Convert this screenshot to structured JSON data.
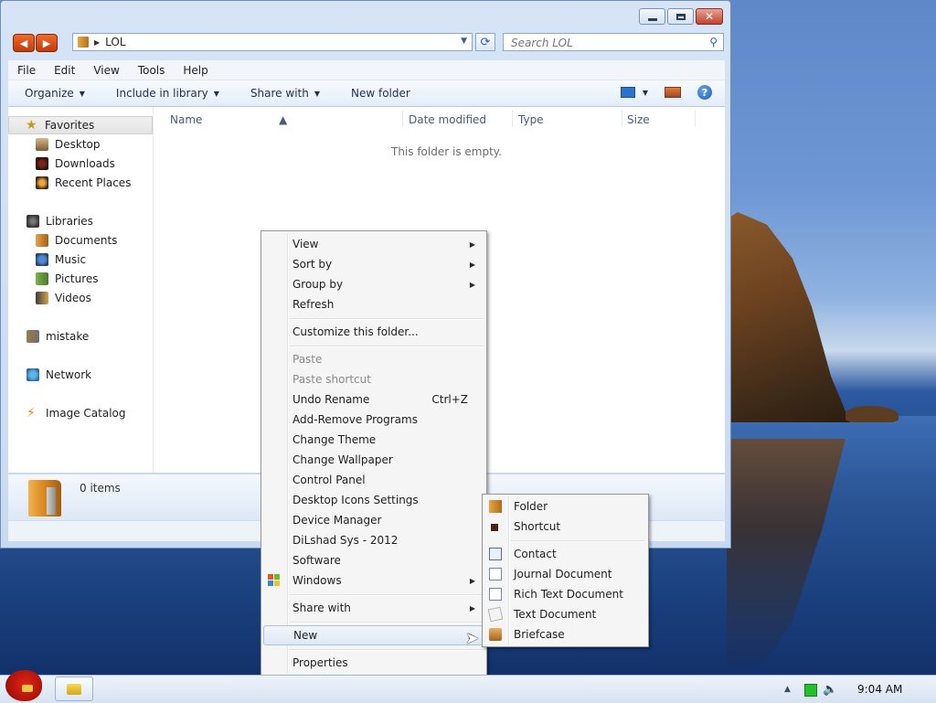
{
  "window": {
    "address_path": "LOL",
    "search_placeholder": "Search LOL"
  },
  "menubar": [
    "File",
    "Edit",
    "View",
    "Tools",
    "Help"
  ],
  "toolbar": {
    "organize": "Organize",
    "include_in_library": "Include in library",
    "share_with": "Share with",
    "new_folder": "New folder"
  },
  "navpane": {
    "favorites": "Favorites",
    "desktop": "Desktop",
    "downloads": "Downloads",
    "recent_places": "Recent Places",
    "libraries": "Libraries",
    "documents": "Documents",
    "music": "Music",
    "pictures": "Pictures",
    "videos": "Videos",
    "user": "mistake",
    "network": "Network",
    "image_catalog": "Image Catalog"
  },
  "columns": {
    "name": "Name",
    "date_modified": "Date modified",
    "type": "Type",
    "size": "Size"
  },
  "content": {
    "empty_message": "This folder is empty."
  },
  "details": {
    "items_count": "0 items"
  },
  "context_menu": {
    "view": "View",
    "sort_by": "Sort by",
    "group_by": "Group by",
    "refresh": "Refresh",
    "customize": "Customize this folder...",
    "paste": "Paste",
    "paste_shortcut": "Paste shortcut",
    "undo_rename": "Undo Rename",
    "undo_shortcut": "Ctrl+Z",
    "add_remove": "Add-Remove Programs",
    "change_theme": "Change Theme",
    "change_wallpaper": "Change Wallpaper",
    "control_panel": "Control Panel",
    "desktop_icons": "Desktop Icons Settings",
    "device_manager": "Device Manager",
    "dilshad": "DiLshad Sys - 2012",
    "software": "Software",
    "windows": "Windows",
    "share_with": "Share with",
    "new": "New",
    "properties": "Properties"
  },
  "new_submenu": {
    "folder": "Folder",
    "shortcut": "Shortcut",
    "contact": "Contact",
    "journal": "Journal Document",
    "rich_text": "Rich Text Document",
    "text": "Text Document",
    "briefcase": "Briefcase"
  },
  "taskbar": {
    "clock": "9:04 AM"
  },
  "colors": {
    "accent": "#2b5eb5",
    "menu_highlight": "#dde8f6"
  }
}
